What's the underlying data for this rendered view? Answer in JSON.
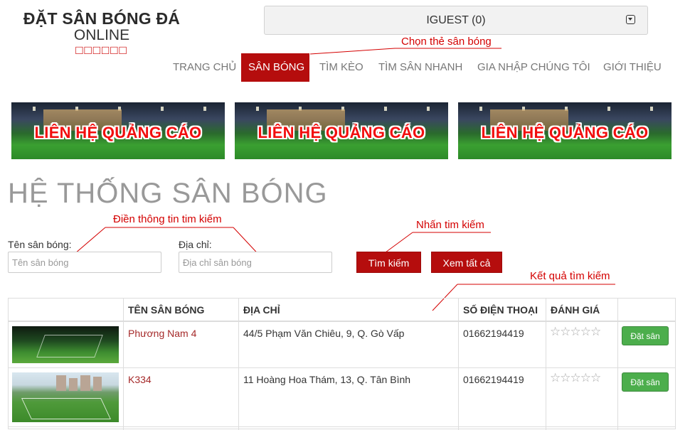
{
  "logo": {
    "line1": "ĐẶT SÂN BÓNG ĐÁ",
    "line2": "ONLINE",
    "line3": "□□□□□□"
  },
  "user_menu": {
    "label": "IGUEST (0)"
  },
  "nav": [
    {
      "label": "TRANG CHỦ",
      "active": false
    },
    {
      "label": "SÂN BÓNG",
      "active": true
    },
    {
      "label": "TÌM KÈO",
      "active": false
    },
    {
      "label": "TÌM SÂN NHANH",
      "active": false
    },
    {
      "label": "GIA NHẬP CHÚNG TÔI",
      "active": false
    },
    {
      "label": "GIỚI THIỆU",
      "active": false
    }
  ],
  "annotations": {
    "choose_field": "Chọn thẻ sân bóng",
    "fill_search": "Điền thông tin tim kiếm",
    "press_search": "Nhấn tim kiếm",
    "search_results": "Kết quả tìm kiếm"
  },
  "banners": [
    {
      "text": "LIÊN HỆ QUẢNG CÁO"
    },
    {
      "text": "LIÊN HỆ QUẢNG CÁO"
    },
    {
      "text": "LIÊN HỆ QUẢNG CÁO"
    }
  ],
  "page_title": "HỆ THỐNG SÂN BÓNG",
  "search": {
    "name_label": "Tên sân bóng:",
    "name_placeholder": "Tên sân bóng",
    "name_value": "",
    "address_label": "Địa chỉ:",
    "address_placeholder": "Địa chỉ sân bóng",
    "address_value": "",
    "search_button": "Tìm kiếm",
    "view_all_button": "Xem tất cả"
  },
  "table": {
    "headers": [
      "",
      "TÊN SÂN BÓNG",
      "ĐỊA CHỈ",
      "SỐ ĐIỆN THOẠI",
      "ĐÁNH GIÁ",
      ""
    ],
    "rows": [
      {
        "name": "Phương Nam 4",
        "address": "44/5 Phạm Văn Chiêu, 9, Q. Gò Vấp",
        "phone": "01662194419",
        "rating": 0,
        "rating_max": 5,
        "stars": "☆☆☆☆☆",
        "action": "Đặt sân"
      },
      {
        "name": "K334",
        "address": "11 Hoàng Hoa Thám, 13, Q. Tân Bình",
        "phone": "01662194419",
        "rating": 0,
        "rating_max": 5,
        "stars": "☆☆☆☆☆",
        "action": "Đặt sân"
      }
    ]
  },
  "colors": {
    "brand_red": "#b50d0d",
    "annotation_red": "#d40000",
    "book_green": "#4cae4c",
    "title_gray": "#999999"
  }
}
